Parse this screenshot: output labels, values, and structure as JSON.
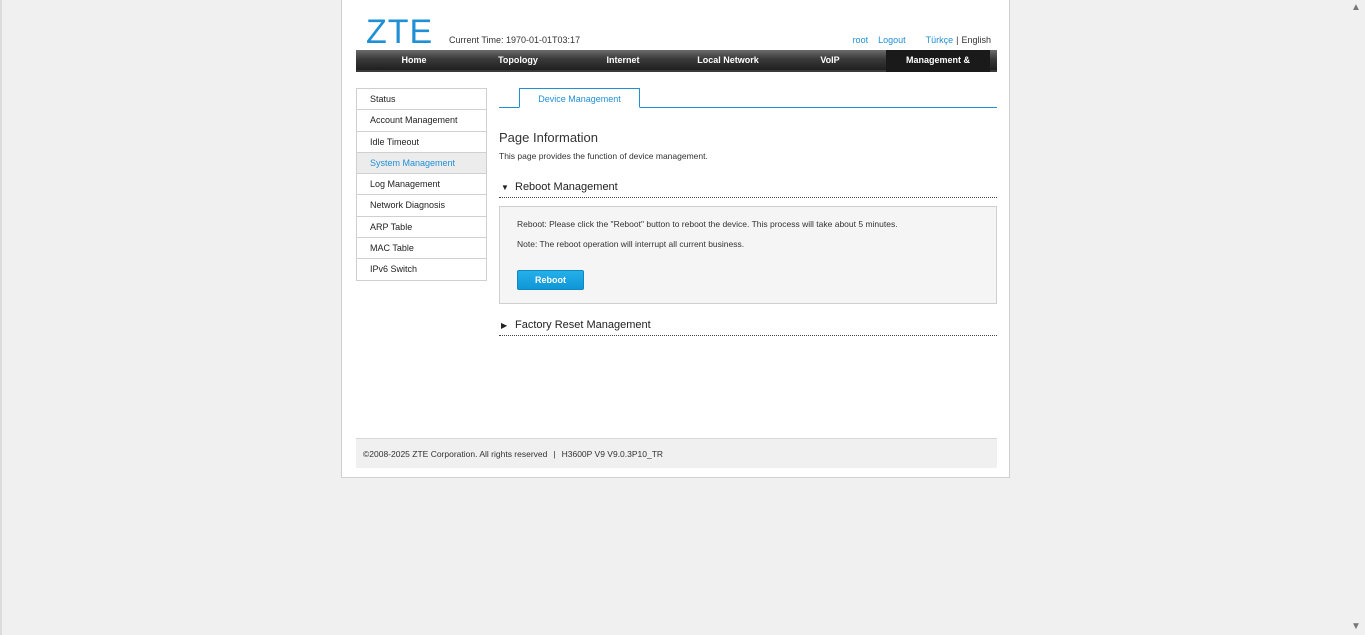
{
  "header": {
    "logo": "ZTE",
    "current_time": "Current Time: 1970-01-01T03:17",
    "user": "root",
    "logout": "Logout",
    "lang_tr": "Türkçe",
    "lang_sep": "|",
    "lang_en": "English"
  },
  "nav": {
    "items": [
      "Home",
      "Topology",
      "Internet",
      "Local Network",
      "VoIP",
      "Management & Diagnosis"
    ],
    "active_index": 5
  },
  "sidebar": {
    "items": [
      "Status",
      "Account Management",
      "Idle Timeout",
      "System Management",
      "Log Management",
      "Network Diagnosis",
      "ARP Table",
      "MAC Table",
      "IPv6 Switch"
    ],
    "active_index": 3
  },
  "tab": {
    "label": "Device Management"
  },
  "page": {
    "title": "Page Information",
    "description": "This page provides the function of device management."
  },
  "reboot": {
    "title": "Reboot Management",
    "expanded_icon": "▼",
    "line1": "Reboot: Please click the \"Reboot\" button to reboot the device. This process will take about 5 minutes.",
    "line2": "Note: The reboot operation will interrupt all current business.",
    "button": "Reboot"
  },
  "factory": {
    "title": "Factory Reset Management",
    "collapsed_icon": "▶"
  },
  "footer": {
    "copyright": "©2008-2025 ZTE Corporation. All rights reserved",
    "sep": "|",
    "version": "H3600P V9 V9.0.3P10_TR"
  },
  "colors": {
    "brand": "#1f8fd6",
    "nav_bg": "#2a2a2a",
    "button": "#0f96d6"
  },
  "scrollbar": {
    "up_icon": "▲",
    "down_icon": "▼"
  }
}
